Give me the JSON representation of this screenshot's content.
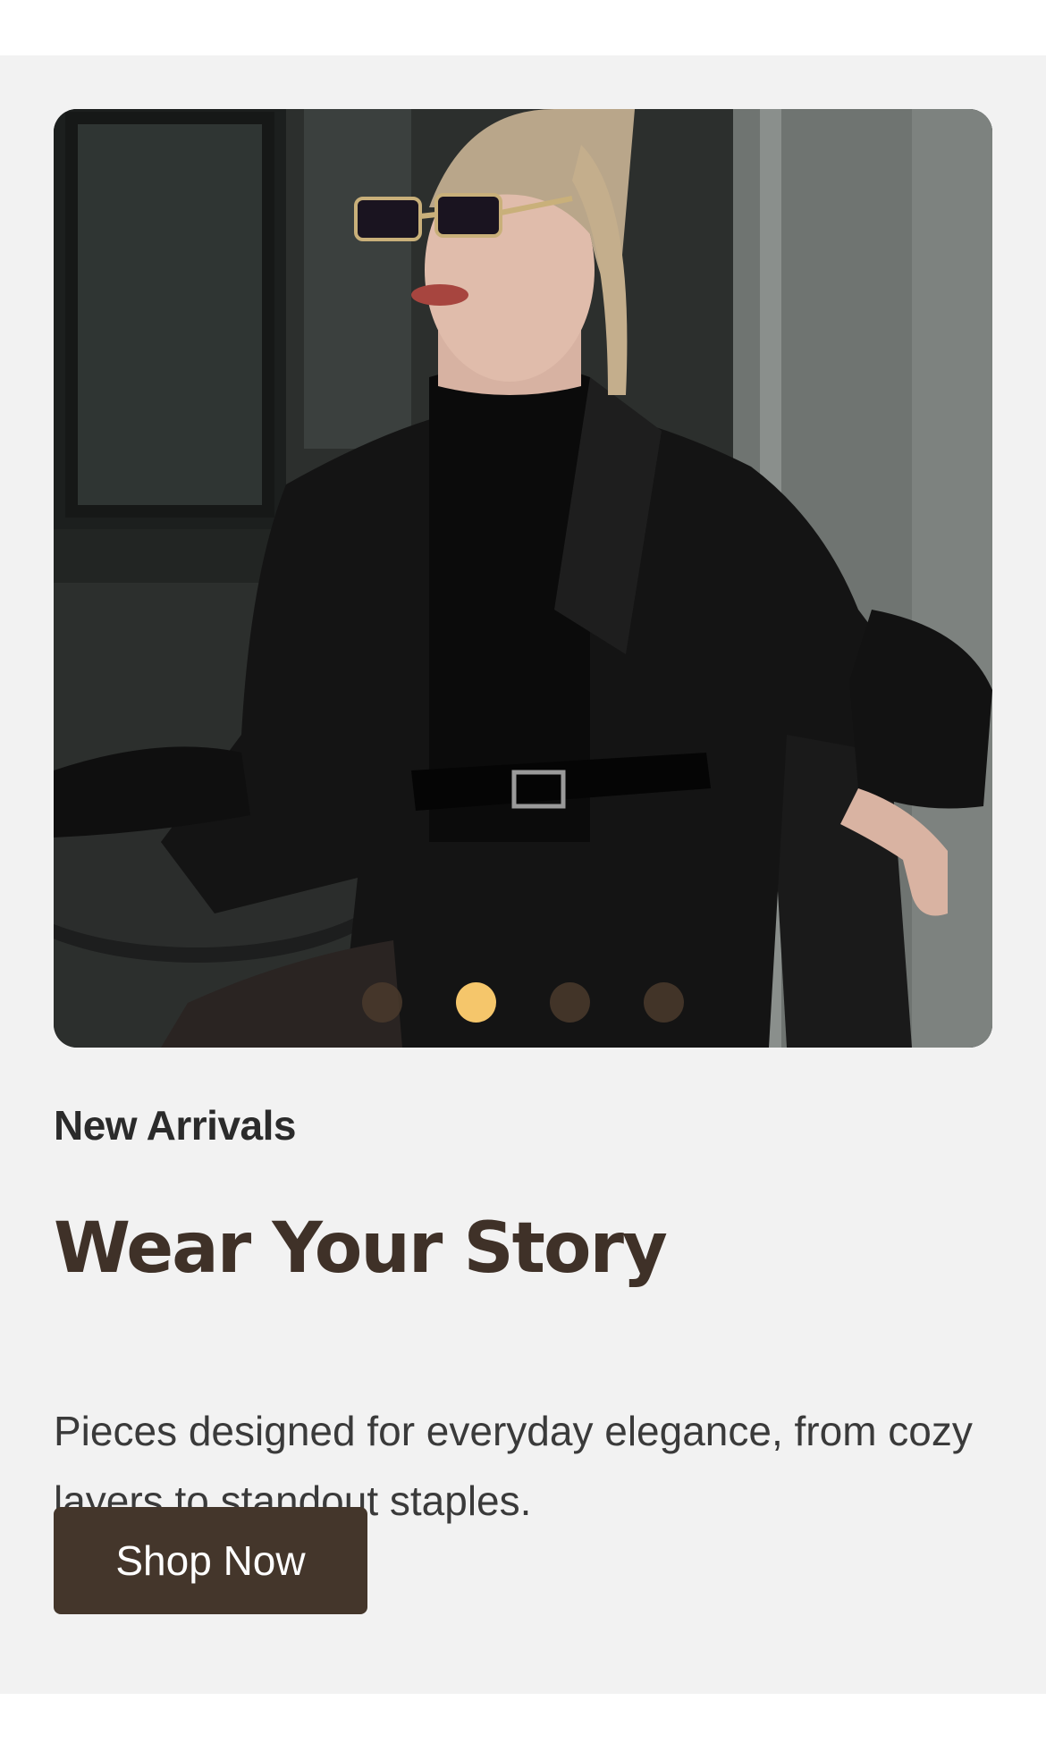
{
  "hero": {
    "image_alt": "Woman in black coat, turtleneck, gloves and sunglasses seated at a cafe table",
    "carousel": {
      "slide_count": 4,
      "active_index": 1,
      "active_color": "#f5c66b",
      "inactive_color": "#4a3a2c"
    }
  },
  "content": {
    "eyebrow": "New Arrivals",
    "headline": "Wear Your Story",
    "description": "Pieces designed for everyday elegance, from cozy layers to standout staples.",
    "cta_label": "Shop Now"
  },
  "colors": {
    "background": "#f2f2f2",
    "headline": "#3f3128",
    "button": "#44362b"
  }
}
